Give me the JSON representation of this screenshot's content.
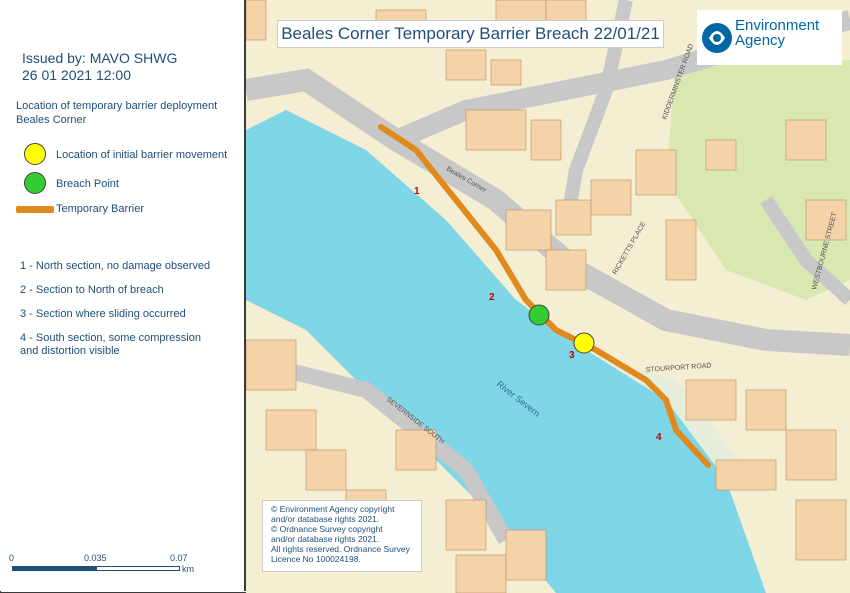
{
  "legend": {
    "issued_by": "Issued by: MAVO SHWG",
    "issued_date": "26 01 2021   12:00",
    "location_heading_1": "Location of temporary barrier deployment",
    "location_heading_2": "Beales Corner",
    "symbols": [
      {
        "label": "Location of initial barrier movement",
        "color": "#ffff00"
      },
      {
        "label": "Breach Point",
        "color": "#33cc33"
      },
      {
        "label": "Temporary Barrier",
        "color": "#e08a1e"
      }
    ],
    "sections": [
      "1 - North section, no damage observed",
      "2 - Section to North of breach",
      "3 - Section where sliding occurred",
      "4 - South section, some compression",
      "and distortion visible"
    ],
    "scale": {
      "ticks": [
        "0",
        "0.035",
        "0.07"
      ],
      "unit": "km"
    }
  },
  "map": {
    "title": "Beales Corner Temporary Barrier Breach 22/01/21",
    "logo_line1": "Environment",
    "logo_line2": "Agency",
    "river_label": "River Severn",
    "section_numbers": [
      "1",
      "2",
      "3",
      "4"
    ],
    "streets": [
      "Beales Corner",
      "Stourport Road",
      "Ricketts Place",
      "Severnside South",
      "Kidderminster Road",
      "Westbourne Street"
    ],
    "copyright_lines": [
      "© Environment Agency copyright",
      "and/or database rights 2021.",
      "© Ordnance Survey copyright",
      "and/or database rights 2021.",
      "All rights reserved.  Ordnance Survey",
      "Licence No 100024198."
    ]
  },
  "colors": {
    "river": "#7fd6e6",
    "road": "#c8c8c8",
    "building": "#f5d3a8",
    "land": "#f4eed2",
    "green": "#d9e8b0",
    "barrier": "#e08a1e",
    "text_blue": "#1f4e79"
  }
}
